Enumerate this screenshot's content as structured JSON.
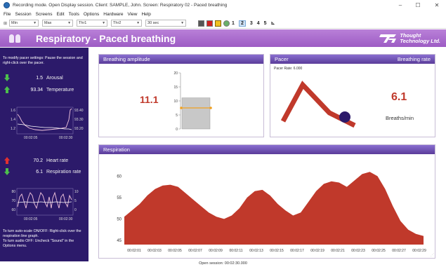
{
  "window": {
    "title": "Recording mode. Open Display session. Client: SAMPLE, John. Screen: Respiratory 02 - Paced breathing",
    "controls": [
      "–",
      "☐",
      "✕"
    ]
  },
  "menu": [
    "File",
    "Session",
    "Screens",
    "Edit",
    "Tools",
    "Options",
    "Hardware",
    "View",
    "Help"
  ],
  "toolbar": {
    "combos": [
      "Min",
      "Max",
      "Thr1",
      "Thr2",
      "30 sec"
    ],
    "screen_numbers": [
      "1",
      "2",
      "3",
      "4",
      "5"
    ],
    "selected_screen": "2"
  },
  "banner": {
    "title": "Respiratory - Paced breathing",
    "logo_line1": "Thought",
    "logo_line2": "Technology Ltd."
  },
  "left_panel": {
    "instruction_top": "To modify pacer settings: Pause the session and right-click over the pacer.",
    "instruction_bottom": "To turn auto-scale ON/OFF: Right-click over the respiration line graph.\nTo turn audio OFF: Uncheck \"Sound\" in the Options menu.",
    "metrics": [
      {
        "value": "1.5",
        "label": "Arousal",
        "arrow": "down",
        "color": "#4cbf4c"
      },
      {
        "value": "93.34",
        "label": "Temperature",
        "arrow": "up",
        "color": "#4cbf4c"
      },
      {
        "value": "70.2",
        "label": "Heart rate",
        "arrow": "up",
        "color": "#e03030"
      },
      {
        "value": "6.1",
        "label": "Respiration rate",
        "arrow": "down",
        "color": "#4cbf4c"
      }
    ],
    "chart1": {
      "left_ticks": [
        "1.6",
        "1.4",
        "1.2"
      ],
      "right_ticks": [
        "93.40",
        "93.30",
        "93.20"
      ],
      "x_ticks": [
        "00:02:05",
        "00:02:30"
      ]
    },
    "chart2": {
      "left_ticks": [
        "80",
        "70",
        "60"
      ],
      "right_ticks": [
        "10",
        "5",
        "0"
      ],
      "x_ticks": [
        "00:02:05",
        "00:02:30"
      ]
    }
  },
  "breathing_amplitude": {
    "title": "Breathing amplitude",
    "value": "11.1",
    "y_ticks": [
      "20",
      "15",
      "10",
      "5",
      "0"
    ],
    "bar_value": 11.1,
    "threshold": 7.5,
    "y_max": 20
  },
  "pacer": {
    "title": "Pacer",
    "right_title": "Breathing rate",
    "pacer_rate_label": "Pacer Rate: 6.000",
    "rate_value": "6.1",
    "rate_unit": "Breaths/min"
  },
  "respiration": {
    "title": "Respiration",
    "y_ticks": [
      "60",
      "55",
      "50",
      "45"
    ],
    "x_ticks": [
      "00:02:01",
      "00:02:03",
      "00:02:05",
      "00:02:07",
      "00:02:09",
      "00:02:11",
      "00:02:13",
      "00:02:15",
      "00:02:17",
      "00:02:19",
      "00:02:21",
      "00:02:23",
      "00:02:25",
      "00:02:27",
      "00:02:29"
    ],
    "ylim": [
      44,
      64
    ],
    "series": [
      50.5,
      52,
      53.5,
      55.5,
      57,
      57.8,
      58,
      57.5,
      56,
      54.5,
      53,
      51.5,
      50.5,
      50,
      50.8,
      52.5,
      55,
      56.5,
      56.8,
      55.5,
      53.5,
      52,
      50.8,
      51.5,
      54,
      56.5,
      58.2,
      58.8,
      58.5,
      57.5,
      59,
      60.5,
      61,
      60,
      57,
      53,
      49.5,
      47.5,
      46.5,
      46
    ],
    "fill_color": "#c0392b"
  },
  "status": "Open session: 00:02:30.000"
}
